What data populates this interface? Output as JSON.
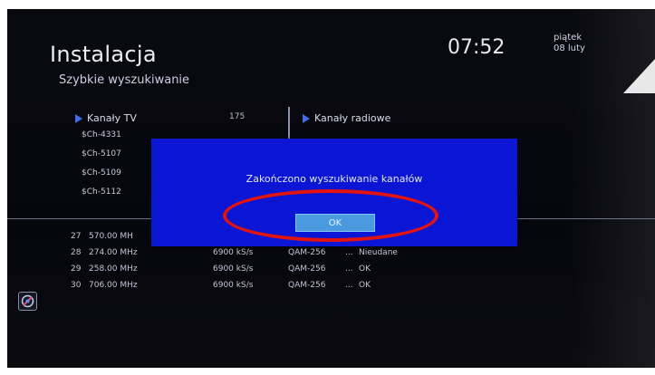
{
  "header": {
    "title": "Instalacja",
    "subtitle": "Szybkie wyszukiwanie",
    "time": "07:52",
    "day": "piątek",
    "date": "08 luty"
  },
  "tv_channels": {
    "label": "Kanały TV",
    "count": "175",
    "items": [
      "$Ch-4331",
      "$Ch-5107",
      "$Ch-5109",
      "$Ch-5112"
    ]
  },
  "radio_channels": {
    "label": "Kanały radiowe"
  },
  "scan_results": [
    {
      "num": "27",
      "freq": "570.00 MH",
      "rate": "",
      "mod": "",
      "dots": "",
      "status": ""
    },
    {
      "num": "28",
      "freq": "274.00 MHz",
      "rate": "6900 kS/s",
      "mod": "QAM-256",
      "dots": "...",
      "status": "Nieudane"
    },
    {
      "num": "29",
      "freq": "258.00 MHz",
      "rate": "6900 kS/s",
      "mod": "QAM-256",
      "dots": "...",
      "status": "OK"
    },
    {
      "num": "30",
      "freq": "706.00 MHz",
      "rate": "6900 kS/s",
      "mod": "QAM-256",
      "dots": "...",
      "status": "OK"
    }
  ],
  "dialog": {
    "message": "Zakończono wyszukiwanie kanałów",
    "ok_label": "OK"
  },
  "colors": {
    "dialog_bg": "#0a16d4",
    "ok_button": "#4a9ae0",
    "highlight": "#e3140e",
    "arrow": "#3f6fe8"
  }
}
